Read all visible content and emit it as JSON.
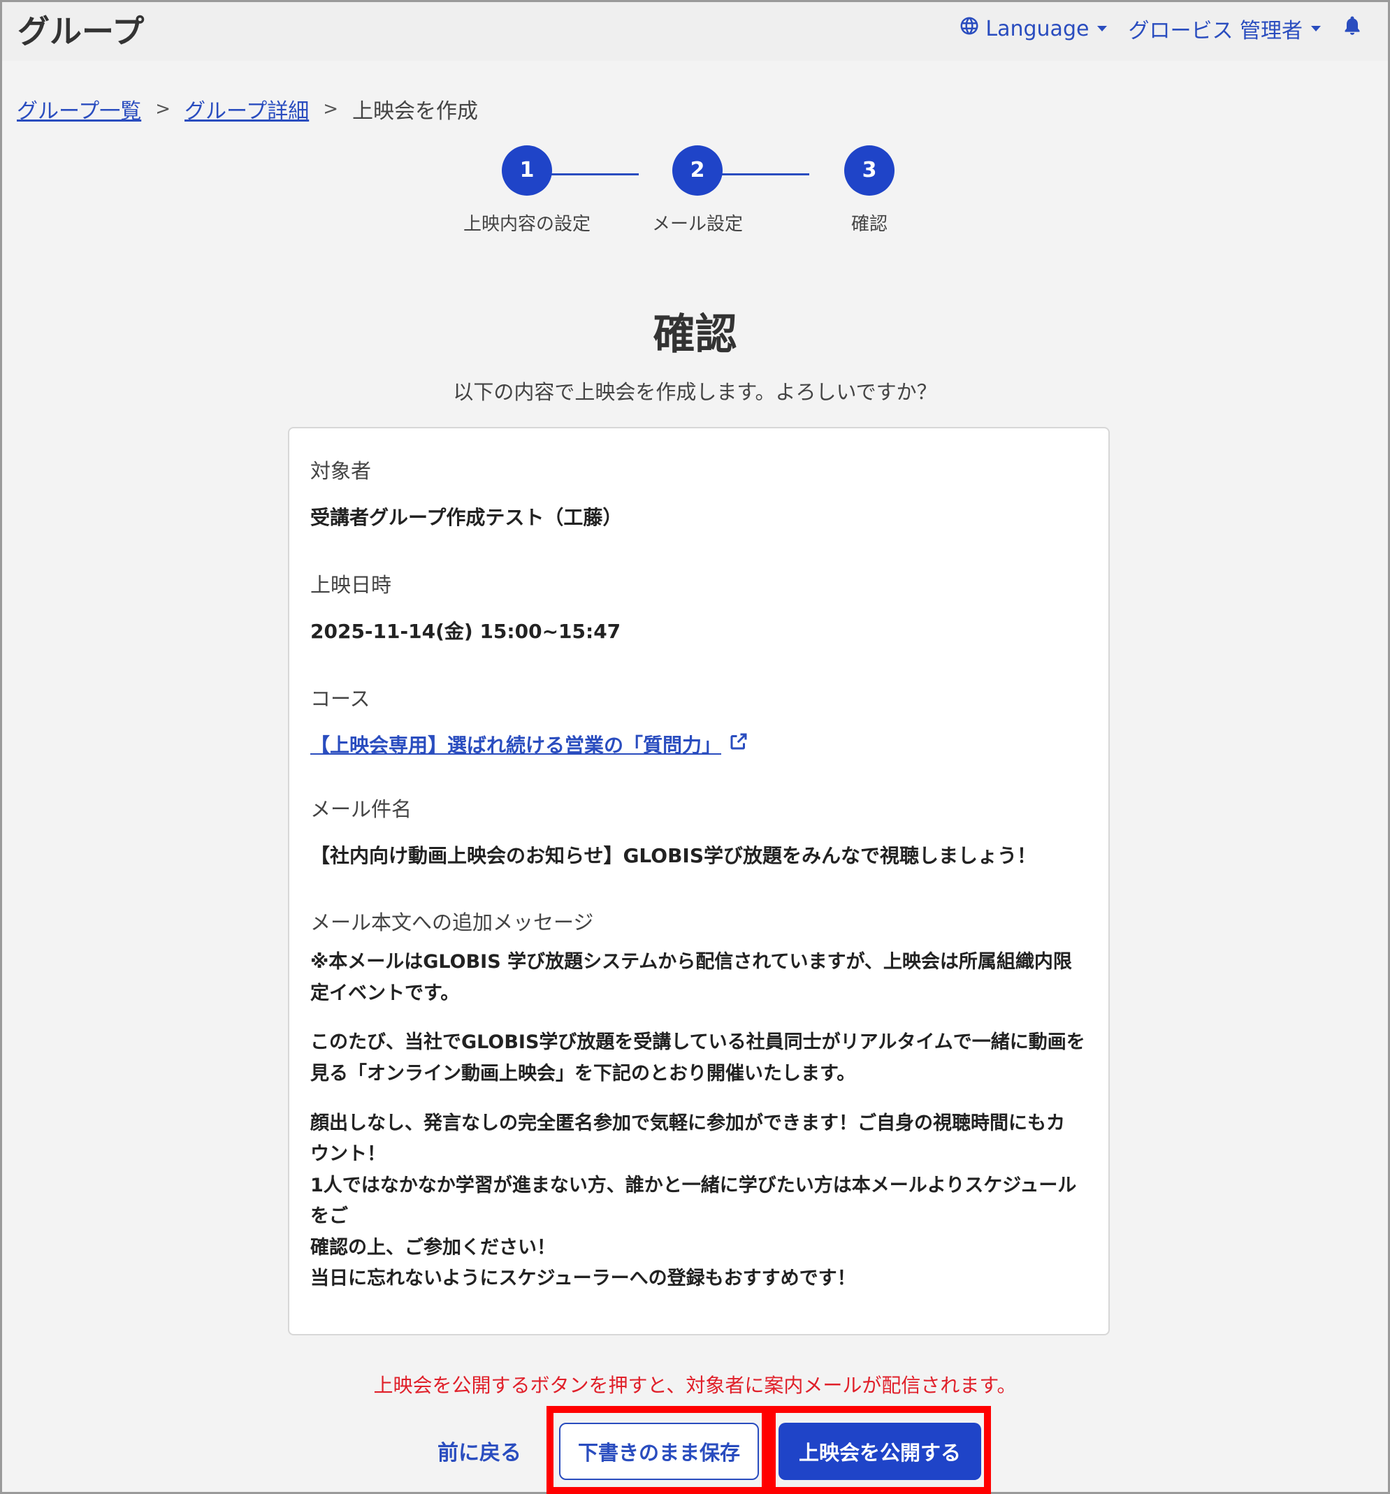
{
  "header": {
    "title": "グループ",
    "language_label": "Language",
    "user_label": "グロービス 管理者"
  },
  "breadcrumb": {
    "items": [
      "グループ一覧",
      "グループ詳細"
    ],
    "separator": ">",
    "current": "上映会を作成"
  },
  "stepper": {
    "steps": [
      {
        "number": "1",
        "label": "上映内容の設定"
      },
      {
        "number": "2",
        "label": "メール設定"
      },
      {
        "number": "3",
        "label": "確認"
      }
    ],
    "active_step": 3
  },
  "page": {
    "title": "確認",
    "subtitle": "以下の内容で上映会を作成します。よろしいですか？"
  },
  "summary": {
    "target": {
      "label": "対象者",
      "value": "受講者グループ作成テスト（工藤）"
    },
    "datetime": {
      "label": "上映日時",
      "value": "2025-11-14(金) 15:00~15:47"
    },
    "course": {
      "label": "コース",
      "value": "【上映会専用】選ばれ続ける営業の「質問力」"
    },
    "mail_subject": {
      "label": "メール件名",
      "value": "【社内向け動画上映会のお知らせ】GLOBIS学び放題をみんなで視聴しましょう！"
    },
    "mail_message": {
      "label": "メール本文への追加メッセージ",
      "paragraphs": [
        {
          "lines": [
            "※本メールはGLOBIS 学び放題システムから配信されていますが、上映会は所属組織内限",
            "定イベントです。"
          ]
        },
        {
          "lines": [
            "このたび、当社でGLOBIS学び放題を受講している社員同士がリアルタイムで一緒に動画を",
            "見る「オンライン動画上映会」を下記のとおり開催いたします。"
          ]
        },
        {
          "lines": [
            "顔出しなし、発言なしの完全匿名参加で気軽に参加ができます！ご自身の視聴時間にもカ",
            "ウント！",
            "1人ではなかなか学習が進まない方、誰かと一緒に学びたい方は本メールよりスケジュールをご",
            "確認の上、ご参加ください！",
            "当日に忘れないようにスケジューラーへの登録もおすすめです！"
          ]
        }
      ]
    }
  },
  "footer": {
    "notice": "上映会を公開するボタンを押すと、対象者に案内メールが配信されます。",
    "back_label": "前に戻る",
    "draft_label": "下書きのまま保存",
    "publish_label": "上映会を公開する"
  },
  "colors": {
    "primary": "#1f44c8",
    "link": "#2a4dbf",
    "notice": "#e0202a",
    "highlight": "#ff0000"
  }
}
